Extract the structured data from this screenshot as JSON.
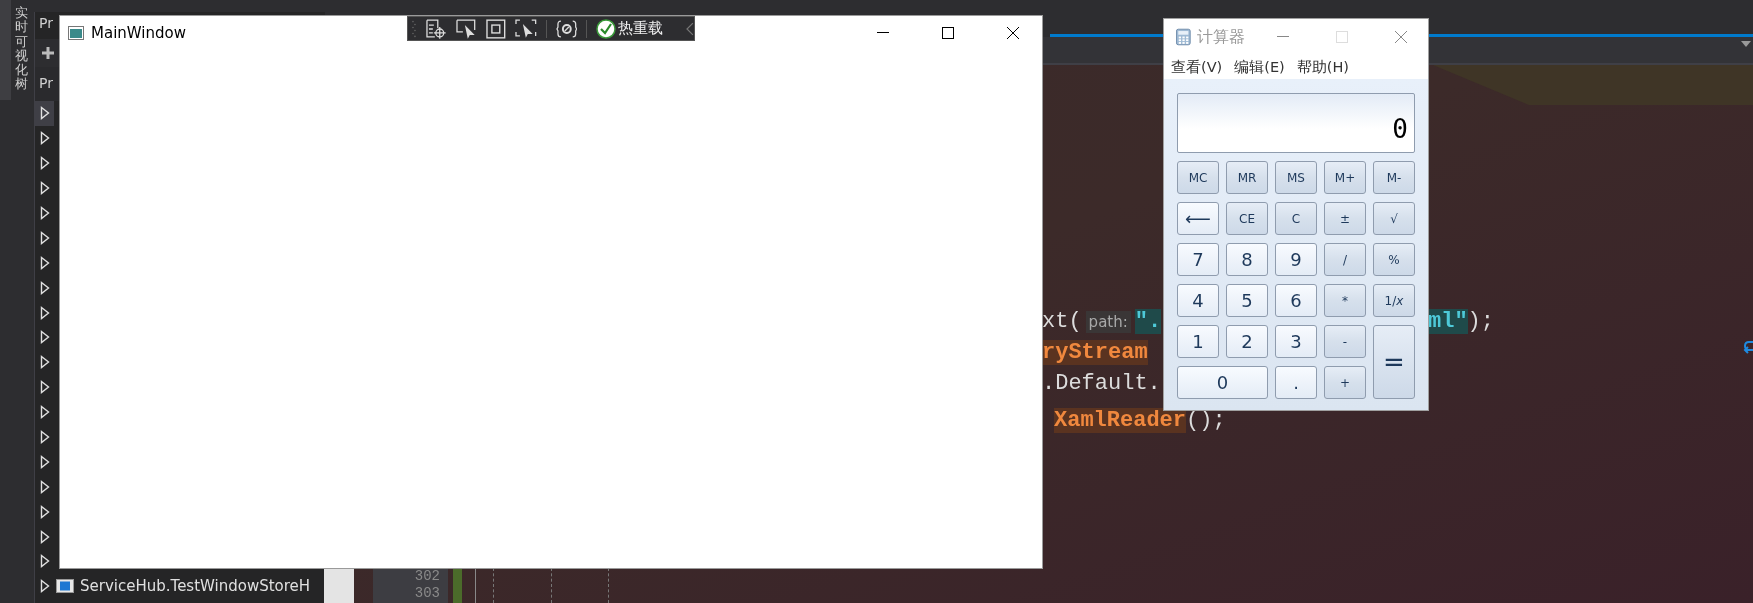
{
  "vertical_tab": {
    "label": "实时可视化树"
  },
  "solution_panel": {
    "title": "Pr",
    "column_header": "Pr"
  },
  "tree_rows": [
    {
      "selected": true
    },
    {
      "selected": false
    },
    {
      "selected": false
    },
    {
      "selected": false
    },
    {
      "selected": false
    },
    {
      "selected": false
    },
    {
      "selected": false
    },
    {
      "selected": false
    },
    {
      "selected": false
    },
    {
      "selected": false
    },
    {
      "selected": false
    },
    {
      "selected": false
    },
    {
      "selected": false
    },
    {
      "selected": false
    },
    {
      "selected": false
    },
    {
      "selected": false
    },
    {
      "selected": false
    },
    {
      "selected": false
    },
    {
      "selected": false
    },
    {
      "selected": false,
      "label": "ServiceHub.TestWindowStoreH"
    }
  ],
  "editor": {
    "code_lines": [
      {
        "left": [
          {
            "kind": "plain",
            "text": "xt("
          },
          {
            "kind": "hint",
            "text": "path:"
          },
          {
            "kind": "string",
            "text": "\"."
          }
        ],
        "right": [
          {
            "kind": "string",
            "text": "ml\""
          },
          {
            "kind": "plain",
            "text": ");"
          }
        ]
      },
      {
        "left": [
          {
            "kind": "type",
            "text": "ryStream"
          }
        ]
      },
      {
        "left": [
          {
            "kind": "plain",
            "text": ".Default."
          }
        ]
      },
      {
        "left": [
          {
            "kind": "type",
            "text": "XamlReader"
          },
          {
            "kind": "plain",
            "text": "();"
          }
        ]
      }
    ],
    "line_numbers": [
      "302",
      "303"
    ]
  },
  "main_window": {
    "title": "MainWindow"
  },
  "debug_toolbar": {
    "hot_reload_label": "热重载"
  },
  "calculator": {
    "title": "计算器",
    "menu": [
      "查看(V)",
      "编辑(E)",
      "帮助(H)"
    ],
    "display": "0",
    "buttons": [
      {
        "label": "MC",
        "kind": "op"
      },
      {
        "label": "MR",
        "kind": "op"
      },
      {
        "label": "MS",
        "kind": "op"
      },
      {
        "label": "M+",
        "kind": "op"
      },
      {
        "label": "M-",
        "kind": "op"
      },
      {
        "label": "⟵",
        "kind": "digit"
      },
      {
        "label": "CE",
        "kind": "op"
      },
      {
        "label": "C",
        "kind": "op"
      },
      {
        "label": "±",
        "kind": "op"
      },
      {
        "label": "√",
        "kind": "op"
      },
      {
        "label": "7",
        "kind": "digit"
      },
      {
        "label": "8",
        "kind": "digit"
      },
      {
        "label": "9",
        "kind": "digit"
      },
      {
        "label": "/",
        "kind": "op"
      },
      {
        "label": "%",
        "kind": "op"
      },
      {
        "label": "4",
        "kind": "digit"
      },
      {
        "label": "5",
        "kind": "digit"
      },
      {
        "label": "6",
        "kind": "digit"
      },
      {
        "label": "*",
        "kind": "op"
      },
      {
        "label": "1/*x*",
        "kind": "op"
      },
      {
        "label": "1",
        "kind": "digit"
      },
      {
        "label": "2",
        "kind": "digit"
      },
      {
        "label": "3",
        "kind": "digit"
      },
      {
        "label": "-",
        "kind": "op"
      },
      {
        "label": "=",
        "kind": "tall"
      },
      {
        "label": "0",
        "kind": "wide"
      },
      {
        "label": ".",
        "kind": "digit"
      },
      {
        "label": "+",
        "kind": "op"
      }
    ]
  }
}
